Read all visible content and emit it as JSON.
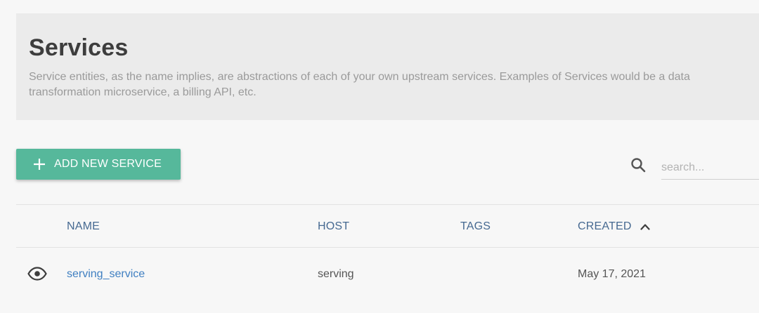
{
  "header": {
    "title": "Services",
    "description": "Service entities, as the name implies, are abstractions of each of your own upstream services. Examples of Services would be a data transformation microservice, a billing API, etc."
  },
  "toolbar": {
    "add_button_label": "ADD NEW SERVICE",
    "add_icon": "plus-icon",
    "search_icon": "search-icon",
    "search_placeholder": "search...",
    "search_value": ""
  },
  "table": {
    "columns": [
      "NAME",
      "HOST",
      "TAGS",
      "CREATED"
    ],
    "sort": {
      "column": "CREATED",
      "direction": "ascending",
      "icon": "chevron-up-icon"
    },
    "rows": [
      {
        "view_icon": "eye-icon",
        "name": "serving_service",
        "host": "serving",
        "tags": "",
        "created": "May 17, 2021"
      }
    ]
  },
  "colors": {
    "accent": "#56b89b",
    "link": "#3f7fc1",
    "header_text": "#466991",
    "panel_bg": "#ebebeb"
  }
}
